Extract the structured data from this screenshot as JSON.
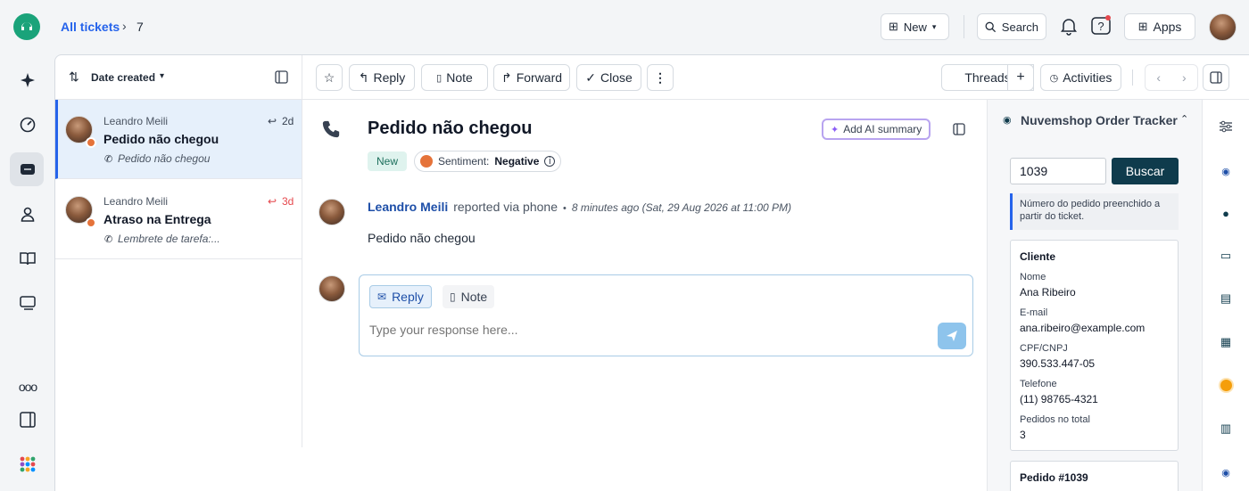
{
  "breadcrumb": {
    "link": "All tickets",
    "ticket_id": "7"
  },
  "topbar": {
    "new_label": "New",
    "search_label": "Search",
    "apps_label": "Apps"
  },
  "list": {
    "sort_label": "Date created",
    "tickets": [
      {
        "name": "Leandro Meili",
        "subject": "Pedido não chegou",
        "preview": "Pedido não chegou",
        "age": "2d",
        "selected": true
      },
      {
        "name": "Leandro Meili",
        "subject": "Atraso na Entrega",
        "preview": "Lembrete de tarefa:...",
        "age": "3d",
        "selected": false
      }
    ]
  },
  "toolbar": {
    "reply": "Reply",
    "note": "Note",
    "forward": "Forward",
    "close": "Close",
    "threads": "Threads",
    "activities": "Activities"
  },
  "ticket": {
    "subject": "Pedido não chegou",
    "status": "New",
    "sentiment_label": "Sentiment:",
    "sentiment_value": "Negative",
    "ai_summary": "Add AI summary",
    "author": "Leandro Meili",
    "via": "reported via phone",
    "timestamp": "8 minutes ago (Sat, 29 Aug 2026 at 11:00 PM)",
    "message": "Pedido não chegou"
  },
  "composer": {
    "reply_tab": "Reply",
    "note_tab": "Note",
    "placeholder": "Type your response here..."
  },
  "app_panel": {
    "title": "Nuvemshop Order Tracker",
    "order_input": "1039",
    "search_button": "Buscar",
    "info": "Número do pedido preenchido a partir do ticket.",
    "client_heading": "Cliente",
    "fields": [
      {
        "label": "Nome",
        "value": "Ana Ribeiro"
      },
      {
        "label": "E-mail",
        "value": "ana.ribeiro@example.com"
      },
      {
        "label": "CPF/CNPJ",
        "value": "390.533.447-05"
      },
      {
        "label": "Telefone",
        "value": "(11) 98765-4321"
      },
      {
        "label": "Pedidos no total",
        "value": "3"
      }
    ],
    "order_heading": "Pedido #1039"
  },
  "colors": {
    "accent": "#2563eb",
    "dark_button": "#0f3b4c",
    "brand": "#1aa37a"
  }
}
